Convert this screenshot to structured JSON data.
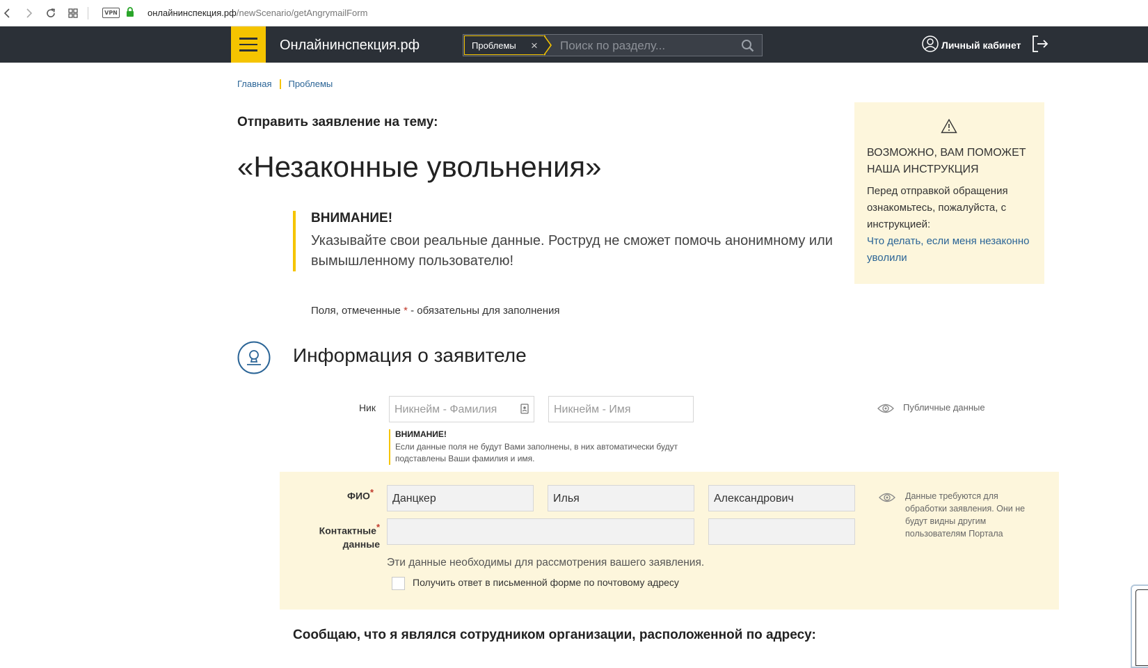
{
  "browser": {
    "url_domain": "онлайнинспекция.рф",
    "url_path": "/newScenario/getAngrymailForm",
    "vpn_label": "VPN"
  },
  "header": {
    "logo": "Онлайнинспекция.рф",
    "search_tag": "Проблемы",
    "search_placeholder": "Поиск по разделу...",
    "cabinet_label": "Личный кабинет",
    "accent_color": "#f5c400",
    "bg_color": "#2b3037"
  },
  "breadcrumbs": [
    "Главная",
    "Проблемы"
  ],
  "page": {
    "send_heading": "Отправить заявление на тему:",
    "topic": "«Незаконные увольнения»",
    "warning_title": "ВНИМАНИЕ!",
    "warning_text": "Указывайте свои реальные данные. Роструд не сможет помочь анонимному или вымышленному пользователю!",
    "required_prefix": "Поля, отмеченные",
    "required_star": "*",
    "required_suffix": " - обязательны для заполнения"
  },
  "info_box": {
    "title": "ВОЗМОЖНО, ВАМ ПОМОЖЕТ НАША ИНСТРУКЦИЯ",
    "text": "Перед отправкой обращения ознакомьтесь, пожалуйста, с инструкцией:",
    "link": "Что делать, если меня незаконно уволили"
  },
  "section": {
    "title": "Информация о заявителе",
    "nick_label": "Ник",
    "nick_surname_placeholder": "Никнейм - Фамилия",
    "nick_name_placeholder": "Никнейм - Имя",
    "nick_warning_title": "ВНИМАНИЕ!",
    "nick_warning_text": "Если данные поля не будут Вами заполнены, в них автоматически будут подставлены Ваши фамилия и имя.",
    "public_label": "Публичные данные",
    "fio_label": "ФИО",
    "fio_surname": "Данцкер",
    "fio_name": "Илья",
    "fio_patronymic": "Александрович",
    "contacts_label_line1": "Контактные",
    "contacts_label_line2": "данные",
    "star": "*",
    "contact_email": "",
    "contact_phone": "",
    "private_note": "Данные требуются для обработки заявления. Они не будут видны другим пользователям Портала",
    "data_note": "Эти данные необходимы для рассмотрения вашего заявления.",
    "postal_checkbox_label": "Получить ответ в письменной форме по почтовому адресу",
    "postal_checked": false
  },
  "bottom_heading": "Сообщаю, что я являлся сотрудником организации, расположенной по адресу:"
}
